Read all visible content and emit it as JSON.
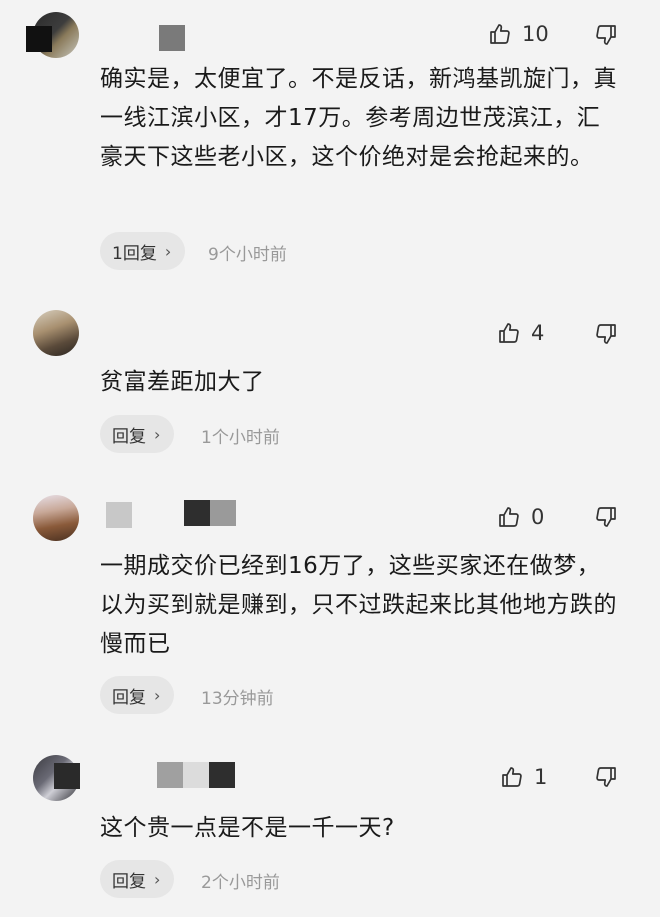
{
  "comments": [
    {
      "likes": "10",
      "text": "确实是，太便宜了。不是反话，新鸿基凯旋门，真一线江滨小区，才17万。参考周边世茂滨江，汇豪天下这些老小区，这个价绝对是会抢起来的。",
      "reply": "1回复",
      "time": "9个小时前"
    },
    {
      "likes": "4",
      "text": "贫富差距加大了",
      "reply": "回复",
      "time": "1个小时前"
    },
    {
      "likes": "0",
      "text": "一期成交价已经到16万了，这些买家还在做梦，以为买到就是赚到，只不过跌起来比其他地方跌的慢而已",
      "reply": "回复",
      "time": "13分钟前"
    },
    {
      "likes": "1",
      "text": "这个贵一点是不是一千一天?",
      "reply": "回复",
      "time": "2个小时前"
    }
  ],
  "colors": {
    "background": "#f3f3f3",
    "pill": "#e6e6e6",
    "time": "#999999"
  },
  "icons": [
    "thumbs-up-icon",
    "thumbs-down-icon",
    "chevron-right-icon"
  ]
}
